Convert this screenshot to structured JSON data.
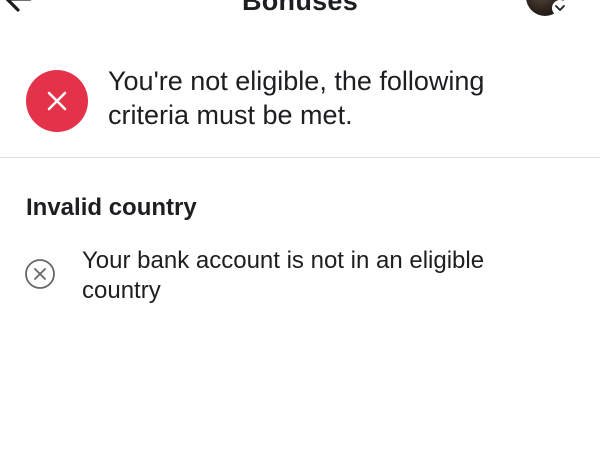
{
  "header": {
    "title": "Bonuses",
    "back_icon": "arrow-left-icon",
    "profile_icon": "avatar",
    "chevron_icon": "chevron-down-icon"
  },
  "notice": {
    "icon": "close-icon",
    "icon_color": "#e4324a",
    "message": "You're not eligible, the following criteria must be met."
  },
  "criteria": {
    "heading": "Invalid country",
    "items": [
      {
        "icon": "circle-x-icon",
        "text": "Your bank account is not in an eligible country"
      }
    ]
  }
}
